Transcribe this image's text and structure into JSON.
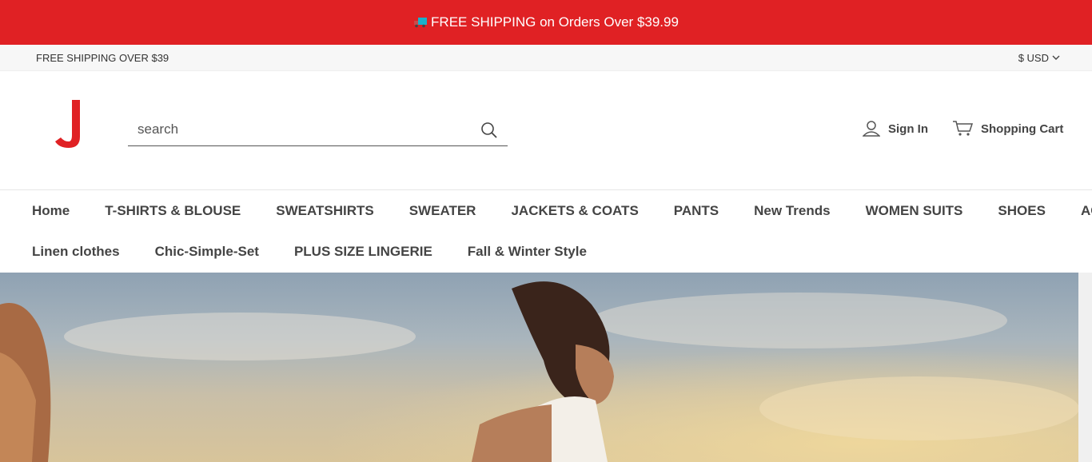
{
  "promo": {
    "text": "FREE SHIPPING on Orders Over $39.99",
    "background": "#e02124"
  },
  "utility": {
    "shipping_note": "FREE SHIPPING OVER $39",
    "currency": "$ USD"
  },
  "header": {
    "search_placeholder": "search",
    "sign_in": "Sign In",
    "cart": "Shopping Cart",
    "brand_color": "#e02124"
  },
  "nav": {
    "row1": [
      "Home",
      "T-SHIRTS & BLOUSE",
      "SWEATSHIRTS",
      "SWEATER",
      "JACKETS & COATS",
      "PANTS",
      "New Trends",
      "WOMEN SUITS",
      "SHOES",
      "ACC"
    ],
    "row2": [
      "Linen clothes",
      "Chic-Simple-Set",
      "PLUS SIZE LINGERIE",
      "Fall & Winter Style"
    ]
  },
  "icons": {
    "promo": "truck-icon",
    "currency": "chevron-down-icon",
    "search": "search-icon",
    "sign_in": "user-icon",
    "cart": "cart-icon"
  }
}
